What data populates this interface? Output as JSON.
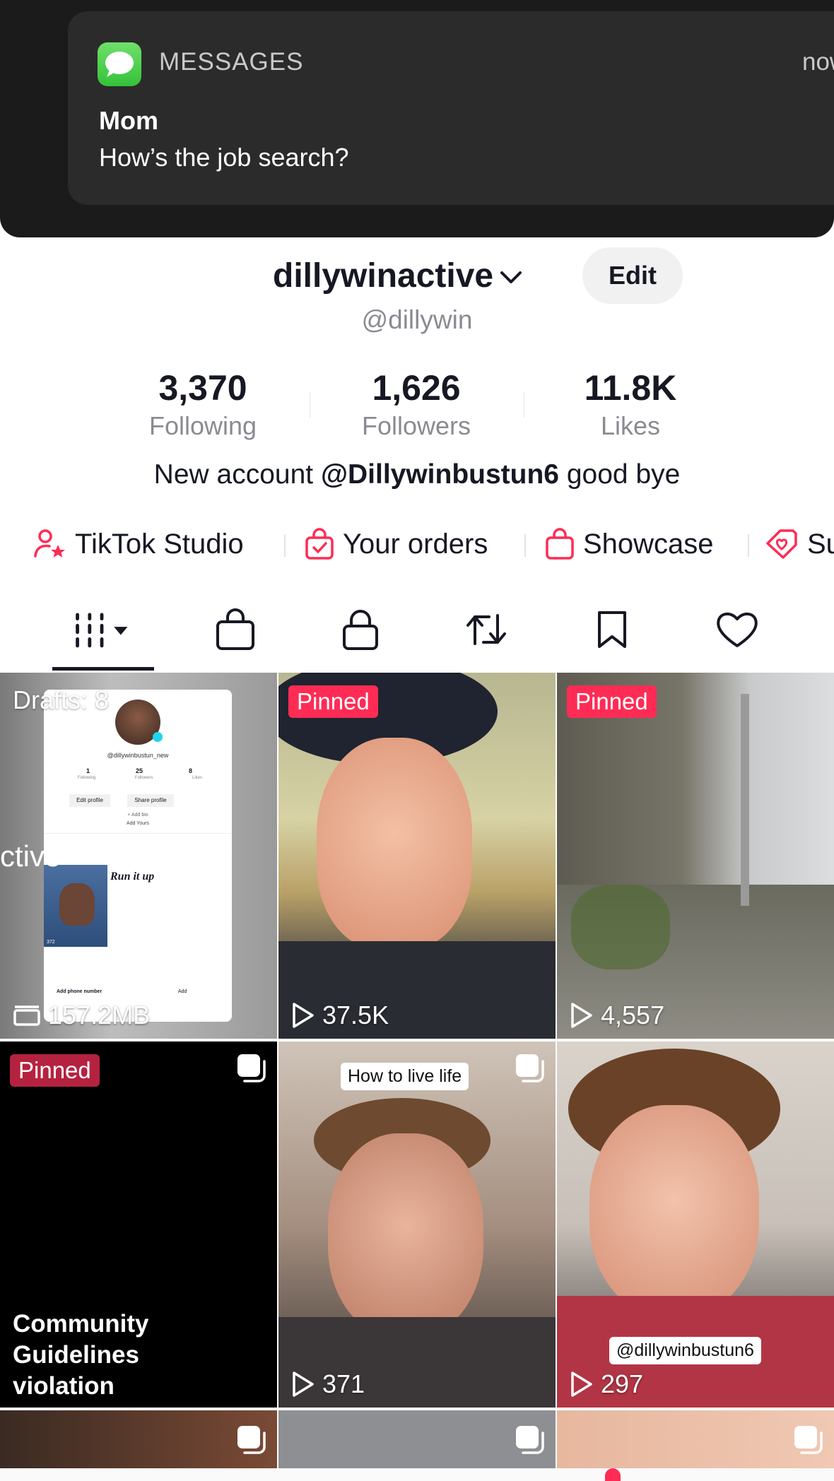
{
  "notification": {
    "app_name": "MESSAGES",
    "time": "now",
    "sender": "Mom",
    "message": "How’s the job search?"
  },
  "profile": {
    "display_name": "dillywinactive",
    "handle": "@dillywin",
    "edit_label": "Edit",
    "stats": [
      {
        "value": "3,370",
        "label": "Following"
      },
      {
        "value": "1,626",
        "label": "Followers"
      },
      {
        "value": "11.8K",
        "label": "Likes"
      }
    ],
    "bio_prefix": "New account",
    "bio_mention": "@Dillywinbustun6",
    "bio_suffix": "good bye"
  },
  "links": [
    {
      "label": "TikTok Studio",
      "icon": "person-star-icon"
    },
    {
      "label": "Your orders",
      "icon": "shopping-bag-check-icon"
    },
    {
      "label": "Showcase",
      "icon": "shopping-bag-icon"
    },
    {
      "label": "Su",
      "icon": "tag-heart-icon"
    }
  ],
  "tabs": [
    "videos-grid-icon",
    "shop-bag-icon",
    "lock-icon",
    "repost-icon",
    "bookmark-icon",
    "heart-icon"
  ],
  "grid": {
    "drafts_label": "Drafts: 8",
    "drafts_size": "157.2MB",
    "draft_preview": {
      "handle": "@dillywinbustun_new",
      "stats": [
        "1",
        "25",
        "8"
      ],
      "stat_labels": [
        "Following",
        "Followers",
        "Likes"
      ],
      "edit_profile": "Edit profile",
      "share_profile": "Share profile",
      "add_bio": "+ Add bio",
      "add_yours": "Add Yours",
      "caption": "Run it up",
      "add_phone": "Add phone number",
      "add": "Add",
      "side_text": "ctive",
      "thumb_views": "372"
    },
    "tiles": [
      {
        "pinned": "Pinned",
        "views": "37.5K"
      },
      {
        "pinned": "Pinned",
        "views": "4,557"
      },
      {
        "pinned": "Pinned",
        "text": "Community Guidelines violation"
      },
      {
        "caption": "How to live life",
        "views": "371"
      },
      {
        "caption": "@dillywinbustun6",
        "views": "297"
      }
    ]
  },
  "colors": {
    "accent": "#fe2c55",
    "text": "#161823",
    "muted": "#8a8b91"
  }
}
